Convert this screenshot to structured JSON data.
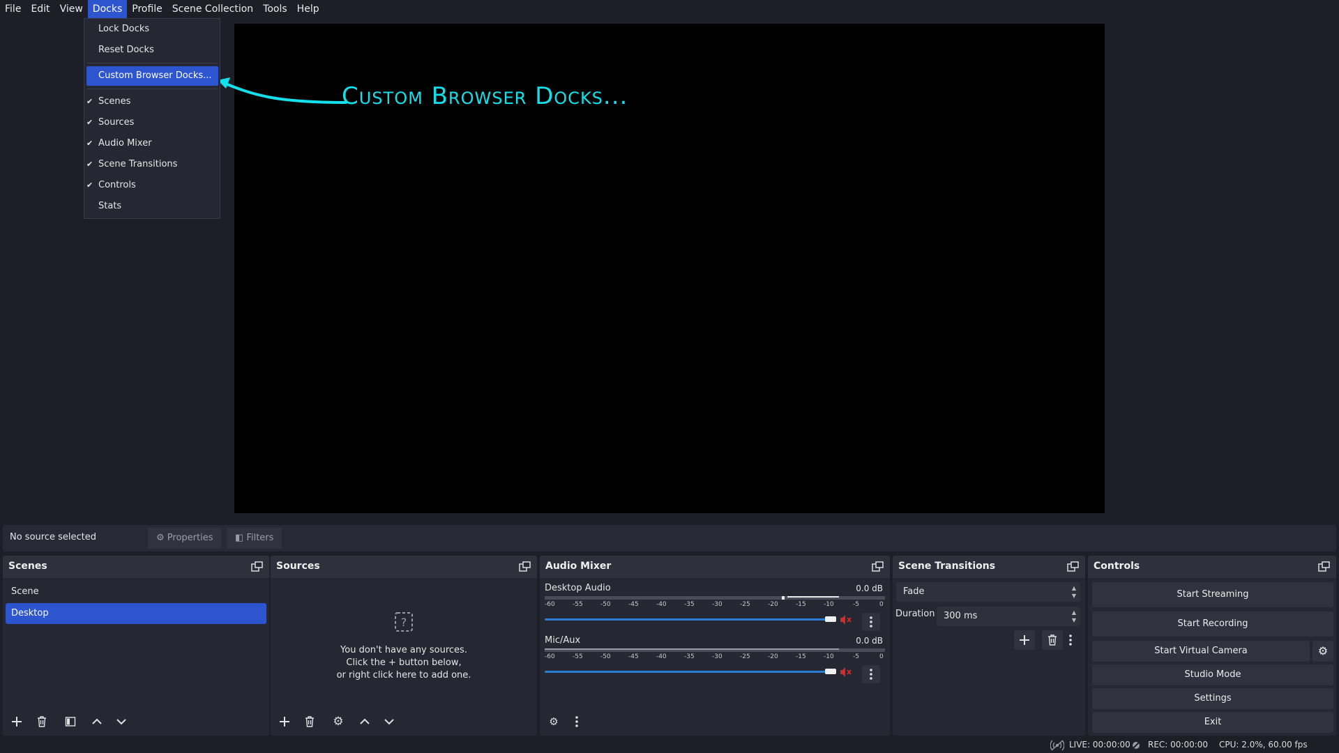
{
  "menubar": {
    "items": [
      "File",
      "Edit",
      "View",
      "Docks",
      "Profile",
      "Scene Collection",
      "Tools",
      "Help"
    ],
    "active": "Docks"
  },
  "docks_menu": {
    "lock": "Lock Docks",
    "reset": "Reset Docks",
    "custom": "Custom Browser Docks...",
    "scenes": "Scenes",
    "sources": "Sources",
    "audio_mixer": "Audio Mixer",
    "scene_transitions": "Scene Transitions",
    "controls": "Controls",
    "stats": "Stats"
  },
  "annotation": "Custom Browser Docks...",
  "source_toolbar": {
    "no_source": "No source selected",
    "properties": "Properties",
    "filters": "Filters"
  },
  "scenes": {
    "title": "Scenes",
    "items": [
      "Scene",
      "Desktop"
    ],
    "selected": "Desktop"
  },
  "sources": {
    "title": "Sources",
    "empty_line1": "You don't have any sources.",
    "empty_line2": "Click the + button below,",
    "empty_line3": "or right click here to add one."
  },
  "audio_mixer": {
    "title": "Audio Mixer",
    "ticks": [
      "-60",
      "-55",
      "-50",
      "-45",
      "-40",
      "-35",
      "-30",
      "-25",
      "-20",
      "-15",
      "-10",
      "-5",
      "0"
    ],
    "channels": [
      {
        "name": "Desktop Audio",
        "db": "0.0 dB",
        "volume_fraction": 1.0,
        "muted": true
      },
      {
        "name": "Mic/Aux",
        "db": "0.0 dB",
        "volume_fraction": 1.0,
        "muted": true
      }
    ]
  },
  "scene_transitions": {
    "title": "Scene Transitions",
    "transition": "Fade",
    "duration_label": "Duration",
    "duration_value": "300 ms"
  },
  "controls": {
    "title": "Controls",
    "start_streaming": "Start Streaming",
    "start_recording": "Start Recording",
    "start_virtual_camera": "Start Virtual Camera",
    "studio_mode": "Studio Mode",
    "settings": "Settings",
    "exit": "Exit"
  },
  "status": {
    "live": "LIVE: 00:00:00",
    "rec": "REC: 00:00:00",
    "cpu": "CPU: 2.0%, 60.00 fps"
  },
  "colors": {
    "accent": "#2d55cf",
    "annotation": "#13e0ea",
    "fader": "#2d7dd6",
    "mute": "#d12b2b"
  }
}
